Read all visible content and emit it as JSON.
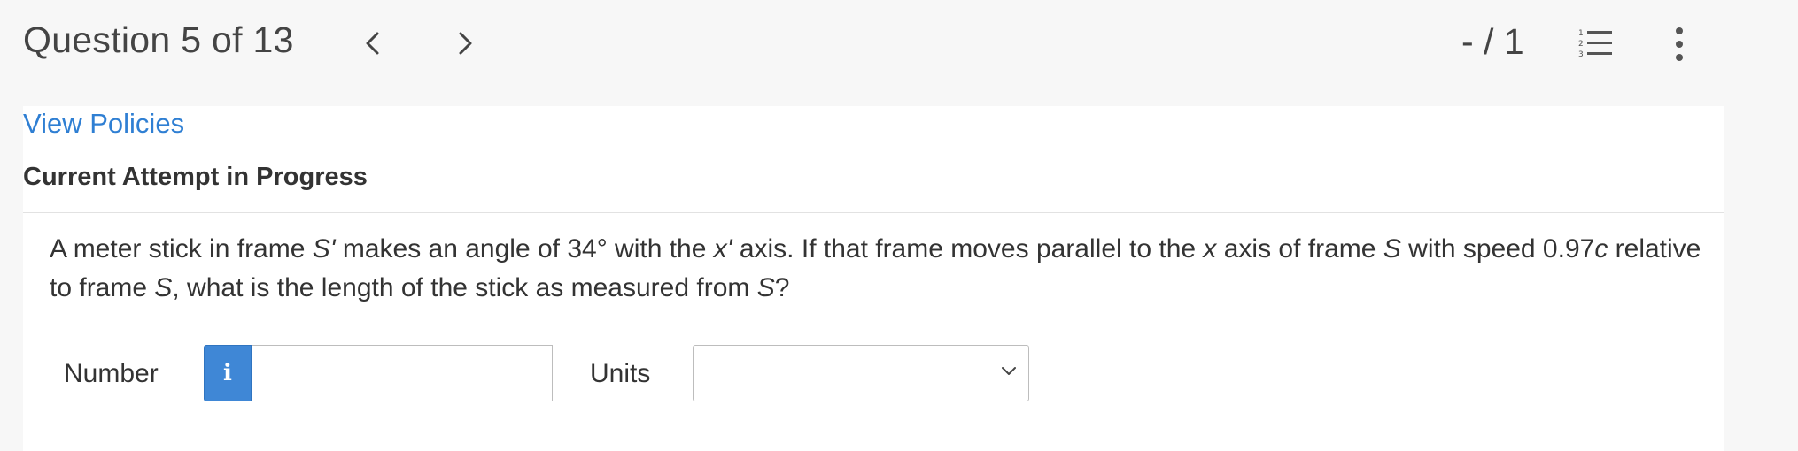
{
  "header": {
    "title": "Question 5 of 13",
    "score": "- / 1",
    "prev_icon": "chevron-left-icon",
    "next_icon": "chevron-right-icon",
    "list_icon": "numbered-list-icon",
    "more_icon": "vertical-dots-icon"
  },
  "panel": {
    "view_policies": "View Policies",
    "attempt_heading": "Current Attempt in Progress"
  },
  "question": {
    "t1": "A meter stick in frame ",
    "v1": "S'",
    "t2": " makes an angle of 34° with the ",
    "v2": "x'",
    "t3": " axis. If that frame moves parallel to the ",
    "v3": "x",
    "t4": " axis of frame ",
    "v4": "S",
    "t5": " with speed 0.97",
    "v5": "c",
    "t6": " relative to frame ",
    "v6": "S",
    "t7": ", what is the length of the stick as measured from ",
    "v7": "S",
    "t8": "?"
  },
  "answer": {
    "number_label": "Number",
    "info_glyph": "i",
    "number_value": "",
    "units_label": "Units",
    "units_value": ""
  },
  "colors": {
    "link": "#2f7fd3",
    "info_button": "#3f87d6",
    "page_bg": "#f7f7f7"
  }
}
